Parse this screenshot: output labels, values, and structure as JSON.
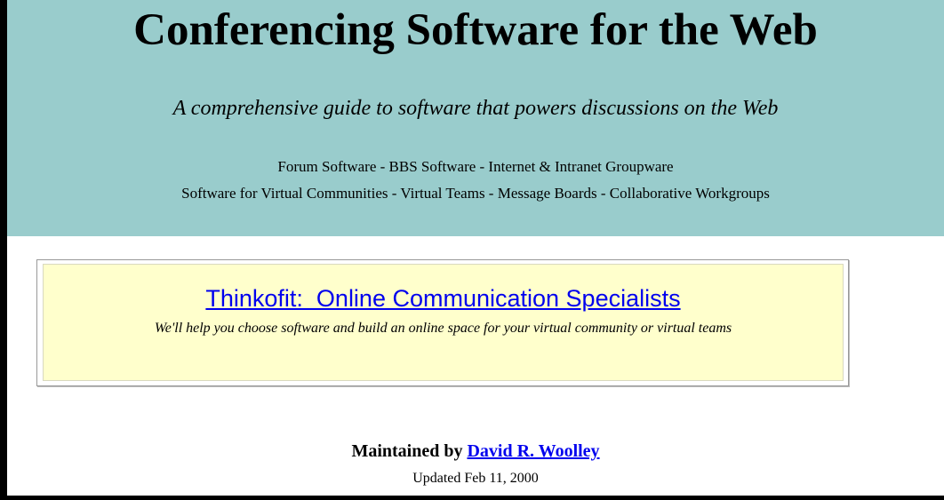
{
  "header": {
    "title": "Conferencing Software for the Web",
    "tagline": "A comprehensive guide to software that powers discussions on the Web",
    "topics_line1": "Forum Software - BBS Software - Internet & Intranet Groupware",
    "topics_line2": "Software for Virtual Communities - Virtual Teams - Message Boards - Collaborative Workgroups"
  },
  "promo": {
    "link_text": "Thinkofit:  Online Communication Specialists",
    "description": "We'll help you choose software and build an online space for your virtual community or virtual teams"
  },
  "footer": {
    "maintained_prefix": "Maintained by ",
    "author": "David R. Woolley",
    "updated": "Updated Feb 11, 2000"
  },
  "colors": {
    "header_bg": "#99cccc",
    "promo_bg": "#ffffcc",
    "link": "#0000ee",
    "frame": "#000000"
  }
}
